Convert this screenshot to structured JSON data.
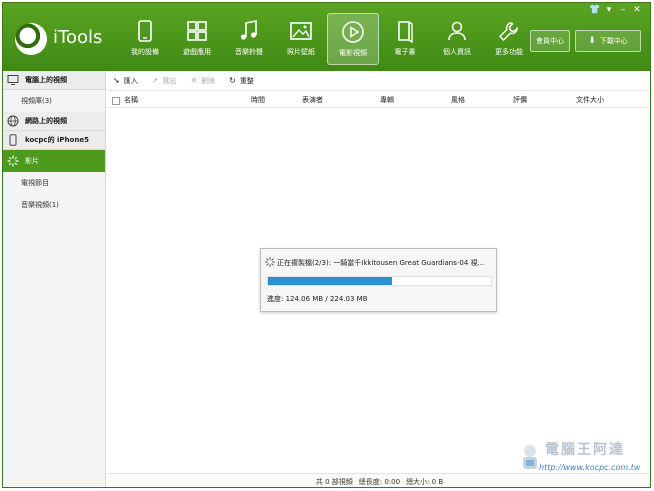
{
  "app": {
    "name": "iTools",
    "brand_color": "#4d9a1c",
    "accent_progress": "#2b8fd0"
  },
  "window_controls": [
    {
      "icon": "shirt-icon"
    },
    {
      "icon": "menu-icon"
    },
    {
      "icon": "minimize-icon"
    },
    {
      "icon": "close-icon"
    }
  ],
  "nav": [
    {
      "label": "我的設備",
      "icon": "phone-icon"
    },
    {
      "label": "遊戲應用",
      "icon": "apps-icon"
    },
    {
      "label": "音樂鈴聲",
      "icon": "music-icon"
    },
    {
      "label": "照片壁紙",
      "icon": "image-icon"
    },
    {
      "label": "電影視頻",
      "icon": "play-icon",
      "active": true
    },
    {
      "label": "電子書",
      "icon": "book-icon"
    },
    {
      "label": "個人資訊",
      "icon": "person-icon"
    },
    {
      "label": "更多功能",
      "icon": "wrench-icon"
    }
  ],
  "header_buttons": {
    "member": "會員中心",
    "download": "下載中心"
  },
  "sidebar": {
    "sections": [
      {
        "label": "電腦上的視頻",
        "icon": "monitor-icon"
      },
      {
        "label": "網路上的視頻",
        "icon": "globe-icon"
      },
      {
        "label": "kocpc的 iPhone5",
        "icon": "device-icon"
      }
    ],
    "items": [
      {
        "label": "視頻庫(3)"
      },
      {
        "label": "影片",
        "active": true
      },
      {
        "label": "電視節目"
      },
      {
        "label": "音樂視頻(1)"
      }
    ]
  },
  "toolbar": {
    "import": "匯入",
    "export": "匯出",
    "delete": "刪除",
    "refresh": "重整"
  },
  "columns": [
    "名稱",
    "時間",
    "表演者",
    "專輯",
    "風格",
    "評價",
    "文件大小"
  ],
  "dialog": {
    "title": "正在複製檔(2/3): 一騎當千Ikkitousen Great Guardians-04 視...",
    "progress_label": "進度: 124.06 MB / 224.03 MB",
    "progress_fraction": 0.554
  },
  "status": {
    "count": "共 0 部視頻",
    "duration": "總長度: 0:00",
    "size": "總大小: 0 B"
  },
  "watermark": {
    "title": "電腦王阿達",
    "url": "http://www.kocpc.com.tw"
  }
}
